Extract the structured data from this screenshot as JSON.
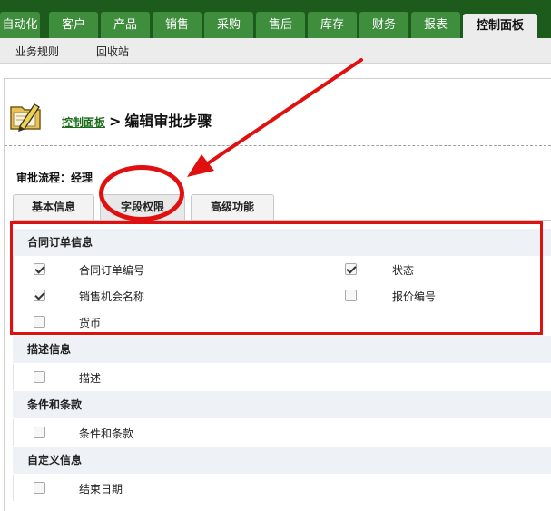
{
  "nav": {
    "tabs": [
      "自动化",
      "客户",
      "产品",
      "销售",
      "采购",
      "售后",
      "库存",
      "财务",
      "报表",
      "控制面板"
    ],
    "active_tab": "控制面板"
  },
  "subnav": {
    "items": [
      "业务规则",
      "回收站"
    ]
  },
  "page": {
    "breadcrumb": "控制面板",
    "separator": ">",
    "title": "编辑审批步骤"
  },
  "flow": {
    "label": "审批流程：",
    "value": "经理"
  },
  "tabs": [
    "基本信息",
    "字段权限",
    "高级功能"
  ],
  "active_tab": "字段权限",
  "sections": [
    {
      "title": "合同订单信息",
      "fields": [
        {
          "label": "合同订单编号",
          "checked": true
        },
        {
          "label": "状态",
          "checked": true
        },
        {
          "label": "销售机会名称",
          "checked": true
        },
        {
          "label": "报价编号",
          "checked": false
        },
        {
          "label": "货币",
          "checked": false
        }
      ]
    },
    {
      "title": "描述信息",
      "fields": [
        {
          "label": "描述",
          "checked": false
        }
      ]
    },
    {
      "title": "条件和条款",
      "fields": [
        {
          "label": "条件和条款",
          "checked": false
        }
      ]
    },
    {
      "title": "自定义信息",
      "fields": [
        {
          "label": "结束日期",
          "checked": false
        }
      ]
    }
  ],
  "colors": {
    "nav_bg": "#1c5b1c",
    "nav_tab": "#3e8e3e",
    "annotation_red": "#e01010",
    "section_bg": "#eef2f7"
  },
  "icons": {
    "app": "pencil-folder-icon"
  }
}
